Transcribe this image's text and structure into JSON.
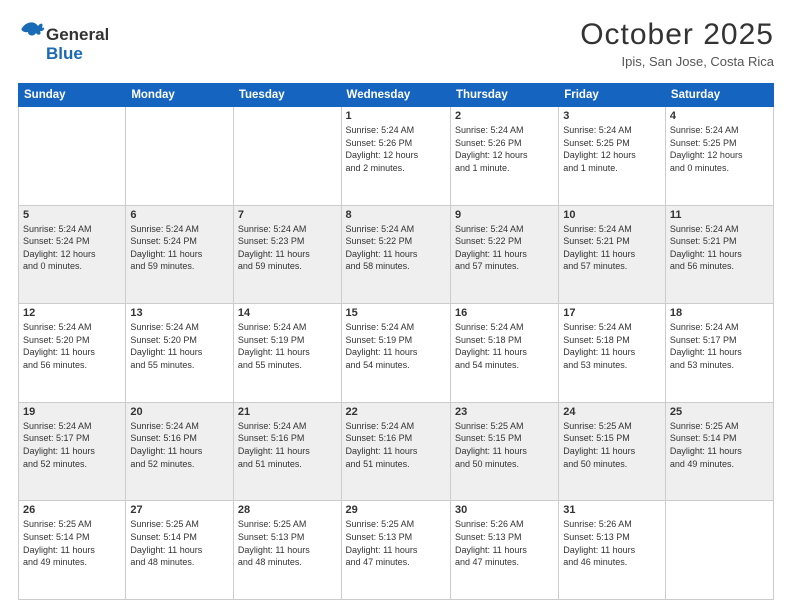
{
  "header": {
    "logo_line1": "General",
    "logo_line2": "Blue",
    "month_title": "October 2025",
    "subtitle": "Ipis, San Jose, Costa Rica"
  },
  "weekdays": [
    "Sunday",
    "Monday",
    "Tuesday",
    "Wednesday",
    "Thursday",
    "Friday",
    "Saturday"
  ],
  "weeks": [
    [
      {
        "day": "",
        "info": ""
      },
      {
        "day": "",
        "info": ""
      },
      {
        "day": "",
        "info": ""
      },
      {
        "day": "1",
        "info": "Sunrise: 5:24 AM\nSunset: 5:26 PM\nDaylight: 12 hours\nand 2 minutes."
      },
      {
        "day": "2",
        "info": "Sunrise: 5:24 AM\nSunset: 5:26 PM\nDaylight: 12 hours\nand 1 minute."
      },
      {
        "day": "3",
        "info": "Sunrise: 5:24 AM\nSunset: 5:25 PM\nDaylight: 12 hours\nand 1 minute."
      },
      {
        "day": "4",
        "info": "Sunrise: 5:24 AM\nSunset: 5:25 PM\nDaylight: 12 hours\nand 0 minutes."
      }
    ],
    [
      {
        "day": "5",
        "info": "Sunrise: 5:24 AM\nSunset: 5:24 PM\nDaylight: 12 hours\nand 0 minutes."
      },
      {
        "day": "6",
        "info": "Sunrise: 5:24 AM\nSunset: 5:24 PM\nDaylight: 11 hours\nand 59 minutes."
      },
      {
        "day": "7",
        "info": "Sunrise: 5:24 AM\nSunset: 5:23 PM\nDaylight: 11 hours\nand 59 minutes."
      },
      {
        "day": "8",
        "info": "Sunrise: 5:24 AM\nSunset: 5:22 PM\nDaylight: 11 hours\nand 58 minutes."
      },
      {
        "day": "9",
        "info": "Sunrise: 5:24 AM\nSunset: 5:22 PM\nDaylight: 11 hours\nand 57 minutes."
      },
      {
        "day": "10",
        "info": "Sunrise: 5:24 AM\nSunset: 5:21 PM\nDaylight: 11 hours\nand 57 minutes."
      },
      {
        "day": "11",
        "info": "Sunrise: 5:24 AM\nSunset: 5:21 PM\nDaylight: 11 hours\nand 56 minutes."
      }
    ],
    [
      {
        "day": "12",
        "info": "Sunrise: 5:24 AM\nSunset: 5:20 PM\nDaylight: 11 hours\nand 56 minutes."
      },
      {
        "day": "13",
        "info": "Sunrise: 5:24 AM\nSunset: 5:20 PM\nDaylight: 11 hours\nand 55 minutes."
      },
      {
        "day": "14",
        "info": "Sunrise: 5:24 AM\nSunset: 5:19 PM\nDaylight: 11 hours\nand 55 minutes."
      },
      {
        "day": "15",
        "info": "Sunrise: 5:24 AM\nSunset: 5:19 PM\nDaylight: 11 hours\nand 54 minutes."
      },
      {
        "day": "16",
        "info": "Sunrise: 5:24 AM\nSunset: 5:18 PM\nDaylight: 11 hours\nand 54 minutes."
      },
      {
        "day": "17",
        "info": "Sunrise: 5:24 AM\nSunset: 5:18 PM\nDaylight: 11 hours\nand 53 minutes."
      },
      {
        "day": "18",
        "info": "Sunrise: 5:24 AM\nSunset: 5:17 PM\nDaylight: 11 hours\nand 53 minutes."
      }
    ],
    [
      {
        "day": "19",
        "info": "Sunrise: 5:24 AM\nSunset: 5:17 PM\nDaylight: 11 hours\nand 52 minutes."
      },
      {
        "day": "20",
        "info": "Sunrise: 5:24 AM\nSunset: 5:16 PM\nDaylight: 11 hours\nand 52 minutes."
      },
      {
        "day": "21",
        "info": "Sunrise: 5:24 AM\nSunset: 5:16 PM\nDaylight: 11 hours\nand 51 minutes."
      },
      {
        "day": "22",
        "info": "Sunrise: 5:24 AM\nSunset: 5:16 PM\nDaylight: 11 hours\nand 51 minutes."
      },
      {
        "day": "23",
        "info": "Sunrise: 5:25 AM\nSunset: 5:15 PM\nDaylight: 11 hours\nand 50 minutes."
      },
      {
        "day": "24",
        "info": "Sunrise: 5:25 AM\nSunset: 5:15 PM\nDaylight: 11 hours\nand 50 minutes."
      },
      {
        "day": "25",
        "info": "Sunrise: 5:25 AM\nSunset: 5:14 PM\nDaylight: 11 hours\nand 49 minutes."
      }
    ],
    [
      {
        "day": "26",
        "info": "Sunrise: 5:25 AM\nSunset: 5:14 PM\nDaylight: 11 hours\nand 49 minutes."
      },
      {
        "day": "27",
        "info": "Sunrise: 5:25 AM\nSunset: 5:14 PM\nDaylight: 11 hours\nand 48 minutes."
      },
      {
        "day": "28",
        "info": "Sunrise: 5:25 AM\nSunset: 5:13 PM\nDaylight: 11 hours\nand 48 minutes."
      },
      {
        "day": "29",
        "info": "Sunrise: 5:25 AM\nSunset: 5:13 PM\nDaylight: 11 hours\nand 47 minutes."
      },
      {
        "day": "30",
        "info": "Sunrise: 5:26 AM\nSunset: 5:13 PM\nDaylight: 11 hours\nand 47 minutes."
      },
      {
        "day": "31",
        "info": "Sunrise: 5:26 AM\nSunset: 5:13 PM\nDaylight: 11 hours\nand 46 minutes."
      },
      {
        "day": "",
        "info": ""
      }
    ]
  ]
}
